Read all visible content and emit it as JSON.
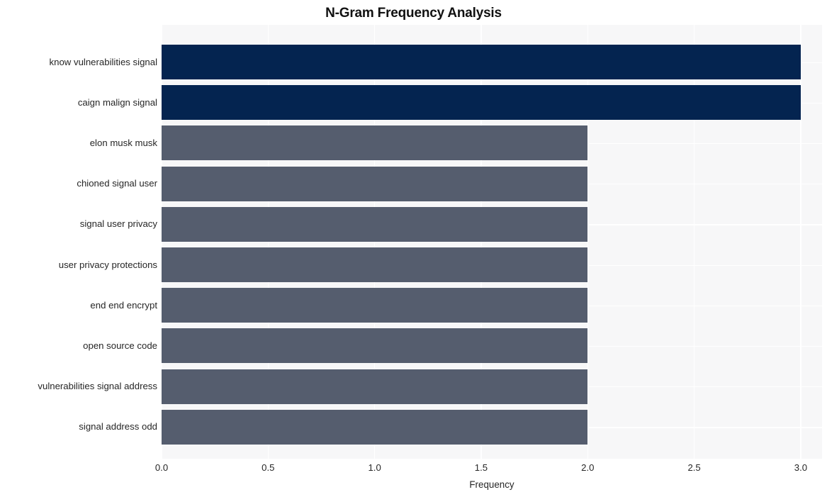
{
  "chart_data": {
    "type": "bar",
    "orientation": "horizontal",
    "title": "N-Gram Frequency Analysis",
    "xlabel": "Frequency",
    "ylabel": "",
    "categories": [
      "know vulnerabilities signal",
      "caign malign signal",
      "elon musk musk",
      "chioned signal user",
      "signal user privacy",
      "user privacy protections",
      "end end encrypt",
      "open source code",
      "vulnerabilities signal address",
      "signal address odd"
    ],
    "values": [
      3,
      3,
      2,
      2,
      2,
      2,
      2,
      2,
      2,
      2
    ],
    "bar_colors": [
      "#042450",
      "#042450",
      "#555d6e",
      "#555d6e",
      "#555d6e",
      "#555d6e",
      "#555d6e",
      "#555d6e",
      "#555d6e",
      "#555d6e"
    ],
    "xlim": [
      0,
      3.1
    ],
    "xticks": [
      0,
      0.5,
      1,
      1.5,
      2,
      2.5,
      3
    ],
    "xtick_labels": [
      "0.0",
      "0.5",
      "1.0",
      "1.5",
      "2.0",
      "2.5",
      "3.0"
    ],
    "grid": true,
    "grid_color": "#ffffff",
    "legend": null,
    "plot_background": "#f7f7f8",
    "figure_background": "#ffffff"
  }
}
